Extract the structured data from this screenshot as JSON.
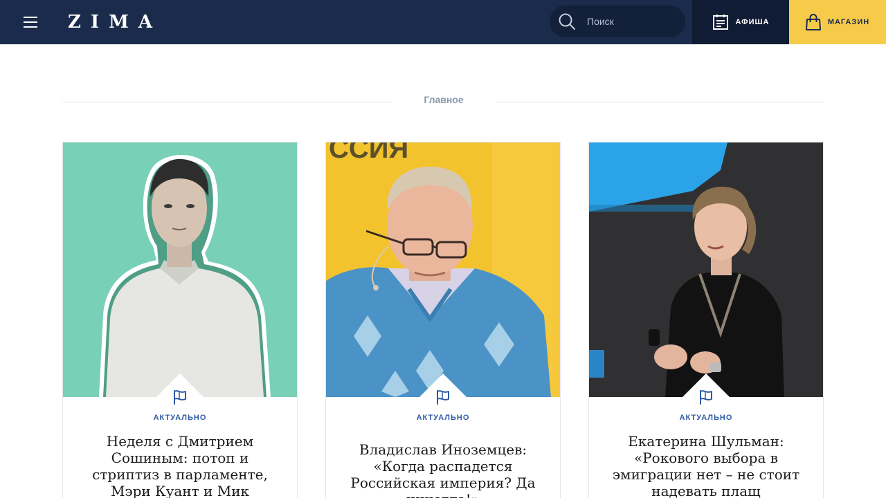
{
  "header": {
    "logo": "ZIMA",
    "search": {
      "placeholder": "Поиск"
    },
    "afisha_label": "АФИША",
    "shop_label": "МАГАЗИН",
    "colors": {
      "background": "#1a2b4c",
      "shop_bg": "#f6cb4a"
    }
  },
  "section": {
    "title": "Главное"
  },
  "cards": [
    {
      "category": "АКТУАЛЬНО",
      "title": "Неделя с Дмитрием Сошиным: потоп и стриптиз в парламенте, Мэри Куант и Мик",
      "image_bg": "#78d0b6",
      "icon": "flag-icon"
    },
    {
      "category": "АКТУАЛЬНО",
      "title": "Владислав Иноземцев: «Когда распадется Российская империя? Да никогда!»",
      "image_bg": "#f3c32e",
      "image_text": "ССИЯ",
      "icon": "flag-icon"
    },
    {
      "category": "АКТУАЛЬНО",
      "title": "Екатерина Шульман: «Рокового выбора в эмиграции нет – не стоит надевать плащ",
      "image_bg": "#2c2c2e",
      "icon": "flag-icon"
    }
  ]
}
